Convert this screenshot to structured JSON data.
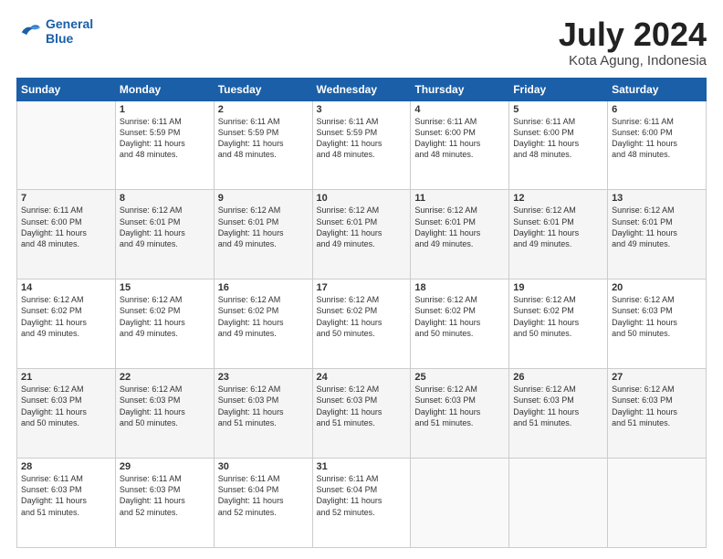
{
  "logo": {
    "line1": "General",
    "line2": "Blue"
  },
  "header": {
    "month_year": "July 2024",
    "location": "Kota Agung, Indonesia"
  },
  "days_of_week": [
    "Sunday",
    "Monday",
    "Tuesday",
    "Wednesday",
    "Thursday",
    "Friday",
    "Saturday"
  ],
  "weeks": [
    [
      {
        "day": "",
        "info": ""
      },
      {
        "day": "1",
        "info": "Sunrise: 6:11 AM\nSunset: 5:59 PM\nDaylight: 11 hours\nand 48 minutes."
      },
      {
        "day": "2",
        "info": "Sunrise: 6:11 AM\nSunset: 5:59 PM\nDaylight: 11 hours\nand 48 minutes."
      },
      {
        "day": "3",
        "info": "Sunrise: 6:11 AM\nSunset: 5:59 PM\nDaylight: 11 hours\nand 48 minutes."
      },
      {
        "day": "4",
        "info": "Sunrise: 6:11 AM\nSunset: 6:00 PM\nDaylight: 11 hours\nand 48 minutes."
      },
      {
        "day": "5",
        "info": "Sunrise: 6:11 AM\nSunset: 6:00 PM\nDaylight: 11 hours\nand 48 minutes."
      },
      {
        "day": "6",
        "info": "Sunrise: 6:11 AM\nSunset: 6:00 PM\nDaylight: 11 hours\nand 48 minutes."
      }
    ],
    [
      {
        "day": "7",
        "info": "Sunrise: 6:11 AM\nSunset: 6:00 PM\nDaylight: 11 hours\nand 48 minutes."
      },
      {
        "day": "8",
        "info": "Sunrise: 6:12 AM\nSunset: 6:01 PM\nDaylight: 11 hours\nand 49 minutes."
      },
      {
        "day": "9",
        "info": "Sunrise: 6:12 AM\nSunset: 6:01 PM\nDaylight: 11 hours\nand 49 minutes."
      },
      {
        "day": "10",
        "info": "Sunrise: 6:12 AM\nSunset: 6:01 PM\nDaylight: 11 hours\nand 49 minutes."
      },
      {
        "day": "11",
        "info": "Sunrise: 6:12 AM\nSunset: 6:01 PM\nDaylight: 11 hours\nand 49 minutes."
      },
      {
        "day": "12",
        "info": "Sunrise: 6:12 AM\nSunset: 6:01 PM\nDaylight: 11 hours\nand 49 minutes."
      },
      {
        "day": "13",
        "info": "Sunrise: 6:12 AM\nSunset: 6:01 PM\nDaylight: 11 hours\nand 49 minutes."
      }
    ],
    [
      {
        "day": "14",
        "info": "Sunrise: 6:12 AM\nSunset: 6:02 PM\nDaylight: 11 hours\nand 49 minutes."
      },
      {
        "day": "15",
        "info": "Sunrise: 6:12 AM\nSunset: 6:02 PM\nDaylight: 11 hours\nand 49 minutes."
      },
      {
        "day": "16",
        "info": "Sunrise: 6:12 AM\nSunset: 6:02 PM\nDaylight: 11 hours\nand 49 minutes."
      },
      {
        "day": "17",
        "info": "Sunrise: 6:12 AM\nSunset: 6:02 PM\nDaylight: 11 hours\nand 50 minutes."
      },
      {
        "day": "18",
        "info": "Sunrise: 6:12 AM\nSunset: 6:02 PM\nDaylight: 11 hours\nand 50 minutes."
      },
      {
        "day": "19",
        "info": "Sunrise: 6:12 AM\nSunset: 6:02 PM\nDaylight: 11 hours\nand 50 minutes."
      },
      {
        "day": "20",
        "info": "Sunrise: 6:12 AM\nSunset: 6:03 PM\nDaylight: 11 hours\nand 50 minutes."
      }
    ],
    [
      {
        "day": "21",
        "info": "Sunrise: 6:12 AM\nSunset: 6:03 PM\nDaylight: 11 hours\nand 50 minutes."
      },
      {
        "day": "22",
        "info": "Sunrise: 6:12 AM\nSunset: 6:03 PM\nDaylight: 11 hours\nand 50 minutes."
      },
      {
        "day": "23",
        "info": "Sunrise: 6:12 AM\nSunset: 6:03 PM\nDaylight: 11 hours\nand 51 minutes."
      },
      {
        "day": "24",
        "info": "Sunrise: 6:12 AM\nSunset: 6:03 PM\nDaylight: 11 hours\nand 51 minutes."
      },
      {
        "day": "25",
        "info": "Sunrise: 6:12 AM\nSunset: 6:03 PM\nDaylight: 11 hours\nand 51 minutes."
      },
      {
        "day": "26",
        "info": "Sunrise: 6:12 AM\nSunset: 6:03 PM\nDaylight: 11 hours\nand 51 minutes."
      },
      {
        "day": "27",
        "info": "Sunrise: 6:12 AM\nSunset: 6:03 PM\nDaylight: 11 hours\nand 51 minutes."
      }
    ],
    [
      {
        "day": "28",
        "info": "Sunrise: 6:11 AM\nSunset: 6:03 PM\nDaylight: 11 hours\nand 51 minutes."
      },
      {
        "day": "29",
        "info": "Sunrise: 6:11 AM\nSunset: 6:03 PM\nDaylight: 11 hours\nand 52 minutes."
      },
      {
        "day": "30",
        "info": "Sunrise: 6:11 AM\nSunset: 6:04 PM\nDaylight: 11 hours\nand 52 minutes."
      },
      {
        "day": "31",
        "info": "Sunrise: 6:11 AM\nSunset: 6:04 PM\nDaylight: 11 hours\nand 52 minutes."
      },
      {
        "day": "",
        "info": ""
      },
      {
        "day": "",
        "info": ""
      },
      {
        "day": "",
        "info": ""
      }
    ]
  ]
}
